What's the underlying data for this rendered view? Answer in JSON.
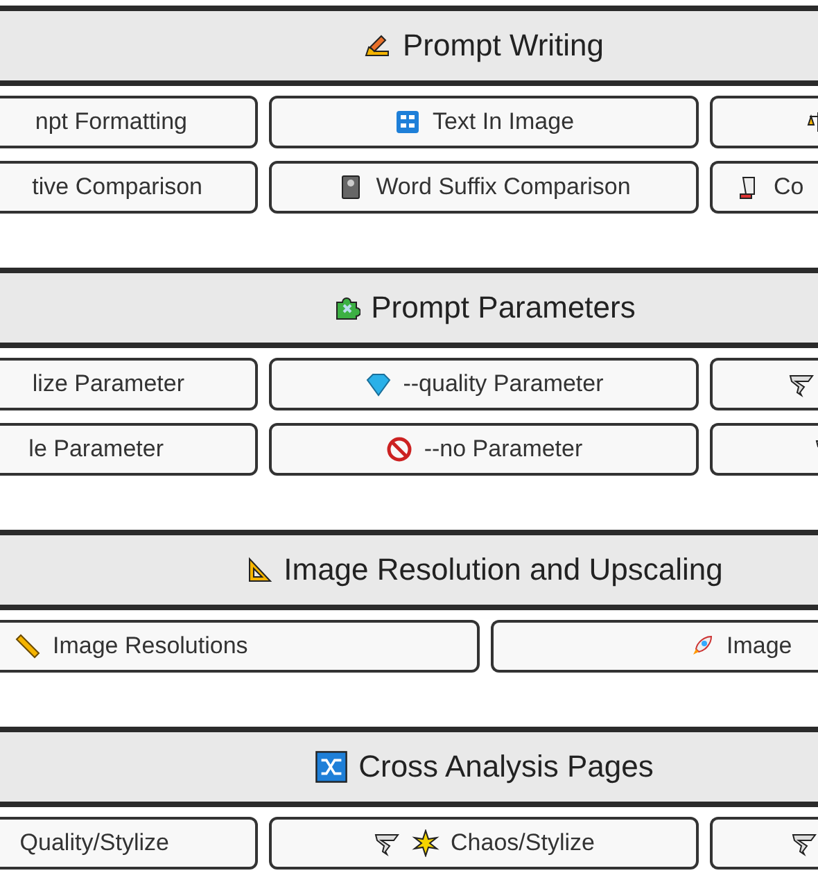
{
  "sections": [
    {
      "title": "Prompt Writing",
      "rows": [
        [
          {
            "label": "npt Formatting"
          },
          {
            "label": "Text In Image"
          },
          {}
        ],
        [
          {
            "label": "tive Comparison"
          },
          {
            "label": "Word Suffix Comparison"
          },
          {
            "label": "Co"
          }
        ]
      ]
    },
    {
      "title": "Prompt Parameters",
      "rows": [
        [
          {
            "label": "lize Parameter"
          },
          {
            "label": "--quality Parameter"
          },
          {}
        ],
        [
          {
            "label": "le Parameter"
          },
          {
            "label": "--no Parameter"
          },
          {}
        ]
      ]
    },
    {
      "title": "Image Resolution and Upscaling",
      "rows": [
        [
          {
            "label": "Image Resolutions"
          },
          {
            "label": "Image"
          }
        ]
      ]
    },
    {
      "title": "Cross Analysis Pages",
      "rows": [
        [
          {
            "label": "Quality/Stylize"
          },
          {
            "label": "Chaos/Stylize"
          },
          {}
        ]
      ]
    }
  ]
}
